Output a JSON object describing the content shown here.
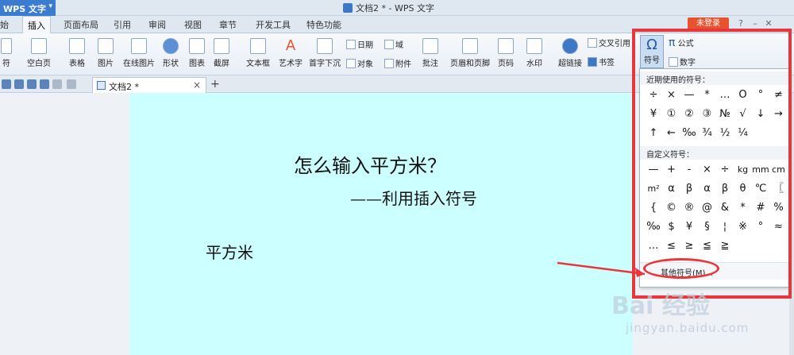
{
  "app": {
    "name": "WPS 文字",
    "window_title": "文档2 * - WPS 文字",
    "login": "未登录"
  },
  "menu_tabs": [
    "始",
    "插入",
    "页面布局",
    "引用",
    "审阅",
    "视图",
    "章节",
    "开发工具",
    "特色功能"
  ],
  "ribbon": {
    "pagebreak": "符",
    "blank_page": "空白页",
    "table": "表格",
    "picture": "图片",
    "online_picture": "在线图片",
    "shape": "形状",
    "chart": "图表",
    "screenshot": "截屏",
    "textbox": "文本框",
    "wordart": "艺术字",
    "dropcap": "首字下沉",
    "date": "日期",
    "object": "对象",
    "field": "域",
    "attachment": "附件",
    "comment": "批注",
    "header_footer": "页眉和页脚",
    "page_number": "页码",
    "watermark": "水印",
    "hyperlink": "超链接",
    "cross_ref": "交叉引用",
    "bookmark": "书签",
    "symbol": "符号",
    "formula": "公式",
    "number": "数字"
  },
  "doc_tab": {
    "name": "文档2 *"
  },
  "document": {
    "title": "怎么输入平方米？",
    "subtitle": "——利用插入符号",
    "word": "平方米"
  },
  "symbol_panel": {
    "recent_label": "近期使用的符号：",
    "recent": [
      "÷",
      "×",
      "—",
      "*",
      "…",
      "O",
      "°",
      "≠",
      "¥",
      "①",
      "②",
      "③",
      "№",
      "√",
      "↓",
      "→",
      "↑",
      "←",
      "‰",
      "¾",
      "½",
      "¼"
    ],
    "custom_label": "自定义符号：",
    "custom": [
      "—",
      "+",
      "-",
      "×",
      "÷",
      "kg",
      "mm",
      "cm",
      "m²",
      "α",
      "β",
      "α",
      "β",
      "θ",
      "℃",
      "〖",
      "{",
      "©",
      "®",
      "@",
      "&",
      "*",
      "#",
      "%",
      "‰",
      "$",
      "¥",
      "§",
      "¦",
      "※",
      "°",
      "≈",
      "…",
      "≤",
      "≥",
      "≦",
      "≧"
    ],
    "more": "其他符号(M)..."
  },
  "watermark": {
    "brand": "Bai  经验",
    "url": "jingyan.baidu.com"
  }
}
